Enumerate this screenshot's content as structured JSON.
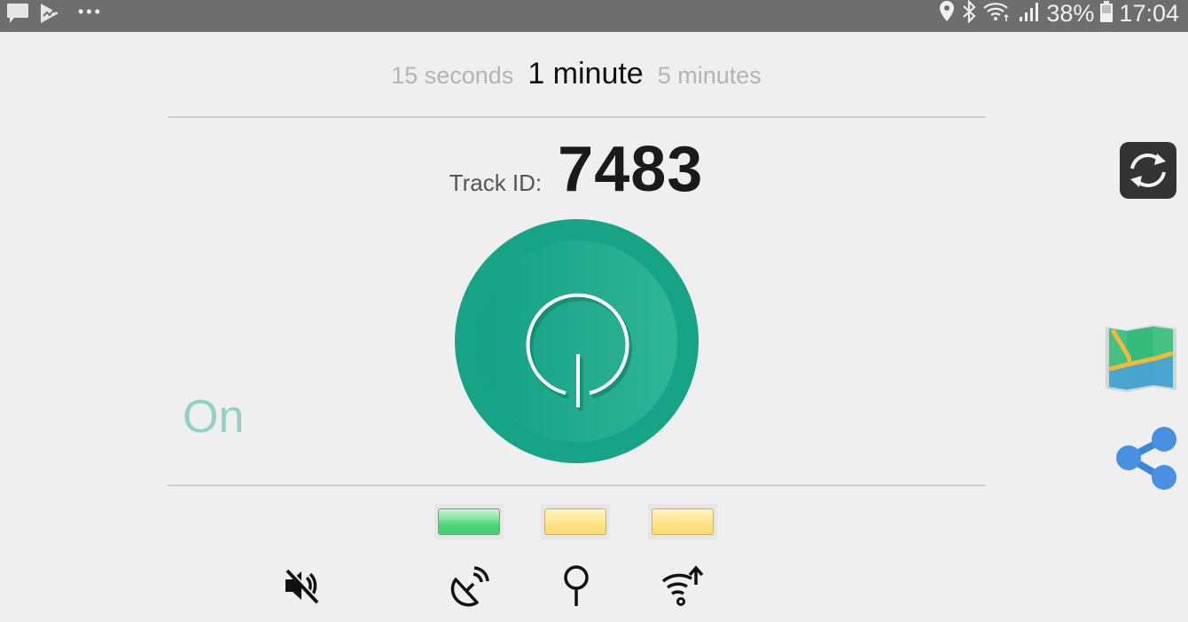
{
  "status_bar": {
    "left_icons": [
      "message-icon",
      "play-store-icon",
      "more-dots-icon"
    ],
    "right_icons": [
      "location-icon",
      "bluetooth-icon",
      "wifi-icon",
      "signal-icon"
    ],
    "battery_percent": "38%",
    "battery_icon": "battery-icon",
    "time": "17:04"
  },
  "interval_selector": {
    "options": [
      {
        "label": "15 seconds",
        "active": false
      },
      {
        "label": "1 minute",
        "active": true
      },
      {
        "label": "5 minutes",
        "active": false
      }
    ]
  },
  "track": {
    "label": "Track ID:",
    "value": "7483"
  },
  "power_button": {
    "icon": "power-icon",
    "color": "#17a385"
  },
  "state_label": "On",
  "indicators": [
    {
      "name": "led-1",
      "status": "green",
      "color": "#44cf70"
    },
    {
      "name": "led-2",
      "status": "yellow",
      "color": "#fde07a"
    },
    {
      "name": "led-3",
      "status": "yellow",
      "color": "#fde07a"
    }
  ],
  "bottom_icons": [
    "sound-off-icon",
    "satellite-icon",
    "location-pin-icon",
    "wifi-upload-icon"
  ],
  "side_actions": {
    "refresh": "refresh-icon",
    "map": "map-icon",
    "share": "share-icon"
  }
}
